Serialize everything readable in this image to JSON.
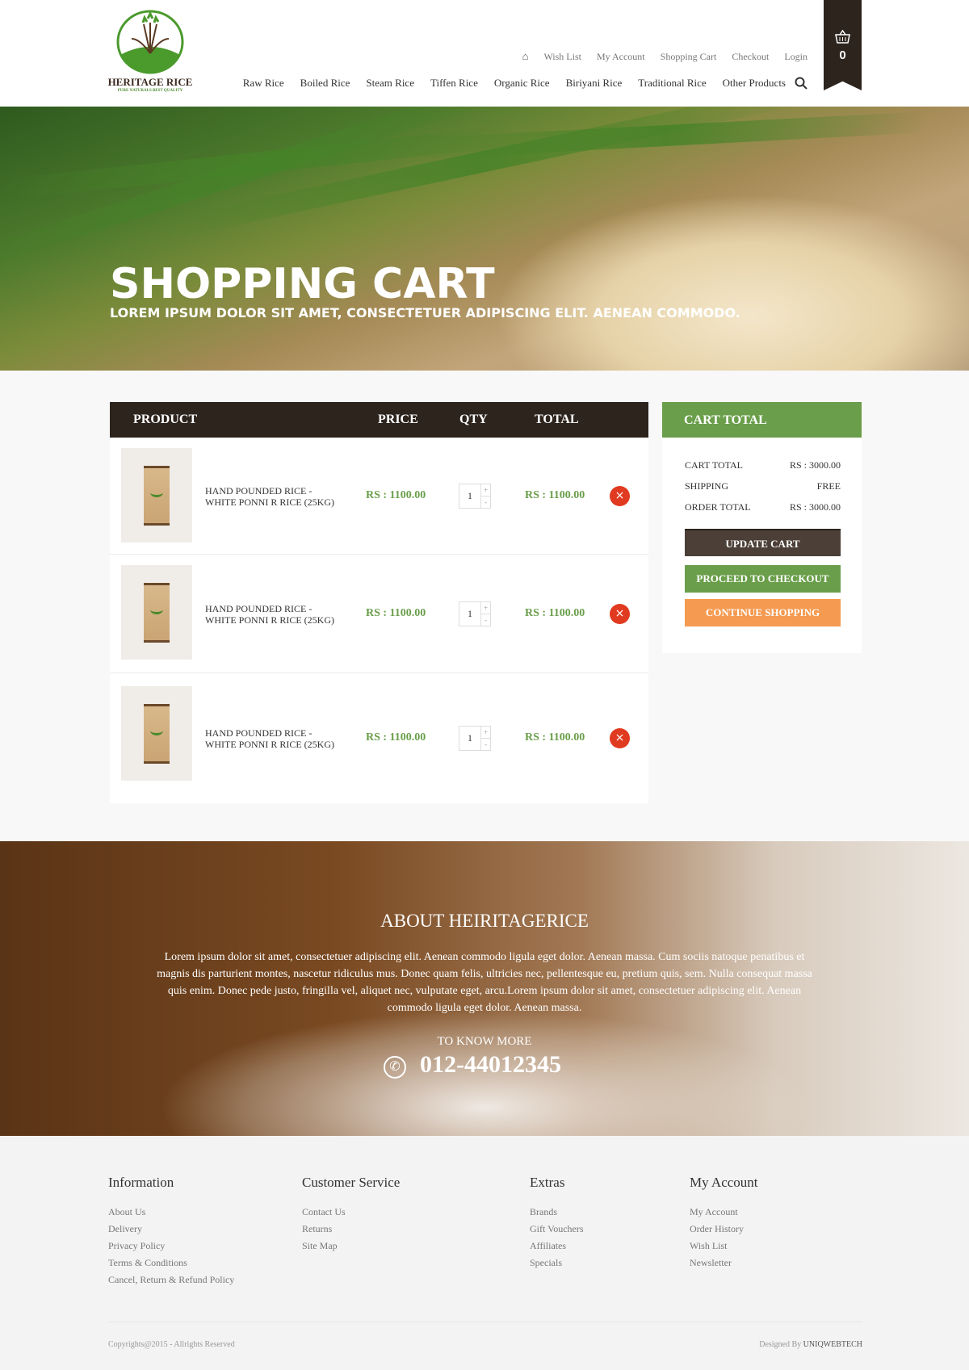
{
  "header": {
    "logo_name": "HERITAGE RICE",
    "logo_tagline": "PURE NATURALS BEST QUALITY",
    "top_links": [
      "Wish List",
      "My Account",
      "Shopping Cart",
      "Checkout",
      "Login"
    ],
    "nav": [
      "Raw Rice",
      "Boiled Rice",
      "Steam Rice",
      "Tiffen Rice",
      "Organic Rice",
      "Biriyani Rice",
      "Traditional Rice",
      "Other Products"
    ],
    "cart_count": "0"
  },
  "hero": {
    "title": "SHOPPING CART",
    "subtitle": "LOREM IPSUM DOLOR SIT AMET, CONSECTETUER ADIPISCING ELIT. AENEAN COMMODO."
  },
  "cart": {
    "headers": {
      "product": "PRODUCT",
      "price": "PRICE",
      "qty": "QTY",
      "total": "TOTAL"
    },
    "items": [
      {
        "name1": "HAND POUNDED RICE -",
        "name2": "WHITE PONNI R RICE (25KG)",
        "price": "RS : 1100.00",
        "qty": "1",
        "total": "RS : 1100.00"
      },
      {
        "name1": "HAND POUNDED RICE -",
        "name2": "WHITE PONNI R RICE (25KG)",
        "price": "RS : 1100.00",
        "qty": "1",
        "total": "RS : 1100.00"
      },
      {
        "name1": "HAND POUNDED RICE -",
        "name2": "WHITE PONNI R RICE (25KG)",
        "price": "RS : 1100.00",
        "qty": "1",
        "total": "RS : 1100.00"
      }
    ],
    "plus": "+",
    "minus": "-",
    "remove": "×"
  },
  "summary": {
    "title": "CART TOTAL",
    "lines": [
      {
        "label": "CART TOTAL",
        "value": "RS : 3000.00"
      },
      {
        "label": "SHIPPING",
        "value": "FREE"
      },
      {
        "label": "ORDER TOTAL",
        "value": "RS : 3000.00"
      }
    ],
    "update": "UPDATE CART",
    "checkout": "PROCEED TO CHECKOUT",
    "continue": "CONTINUE SHOPPING",
    "colors": {
      "dark": "#2d241e",
      "green": "#6a9e4a",
      "orange": "#f59a51",
      "remove": "#e03a20"
    }
  },
  "about": {
    "title": "ABOUT HEIRITAGERICE",
    "text": "Lorem ipsum dolor sit amet, consectetuer adipiscing elit. Aenean commodo ligula eget dolor. Aenean massa. Cum sociis natoque penatibus et magnis dis parturient montes, nascetur ridiculus mus. Donec quam felis, ultricies nec, pellentesque eu, pretium quis, sem. Nulla consequat massa quis enim. Donec pede justo, fringilla vel, aliquet nec, vulputate eget, arcu.Lorem ipsum dolor sit amet, consectetuer adipiscing elit. Aenean commodo ligula eget dolor. Aenean massa.",
    "know_more": "TO KNOW MORE",
    "phone": "012-44012345"
  },
  "footer": {
    "columns": [
      {
        "title": "Information",
        "links": [
          "About Us",
          "Delivery",
          "Privacy Policy",
          "Terms & Conditions",
          "Cancel, Return & Refund Policy"
        ]
      },
      {
        "title": "Customer Service",
        "links": [
          "Contact Us",
          "Returns",
          "Site Map"
        ]
      },
      {
        "title": "Extras",
        "links": [
          "Brands",
          "Gift Vouchers",
          "Affiliates",
          "Specials"
        ]
      },
      {
        "title": "My Account",
        "links": [
          "My Account",
          "Order History",
          "Wish List",
          "Newsletter"
        ]
      }
    ],
    "copyright": "Copyrights@2015 - Allrights Reserved",
    "designed_by": "Designed By",
    "designer": "UNIQWEBTECH"
  }
}
